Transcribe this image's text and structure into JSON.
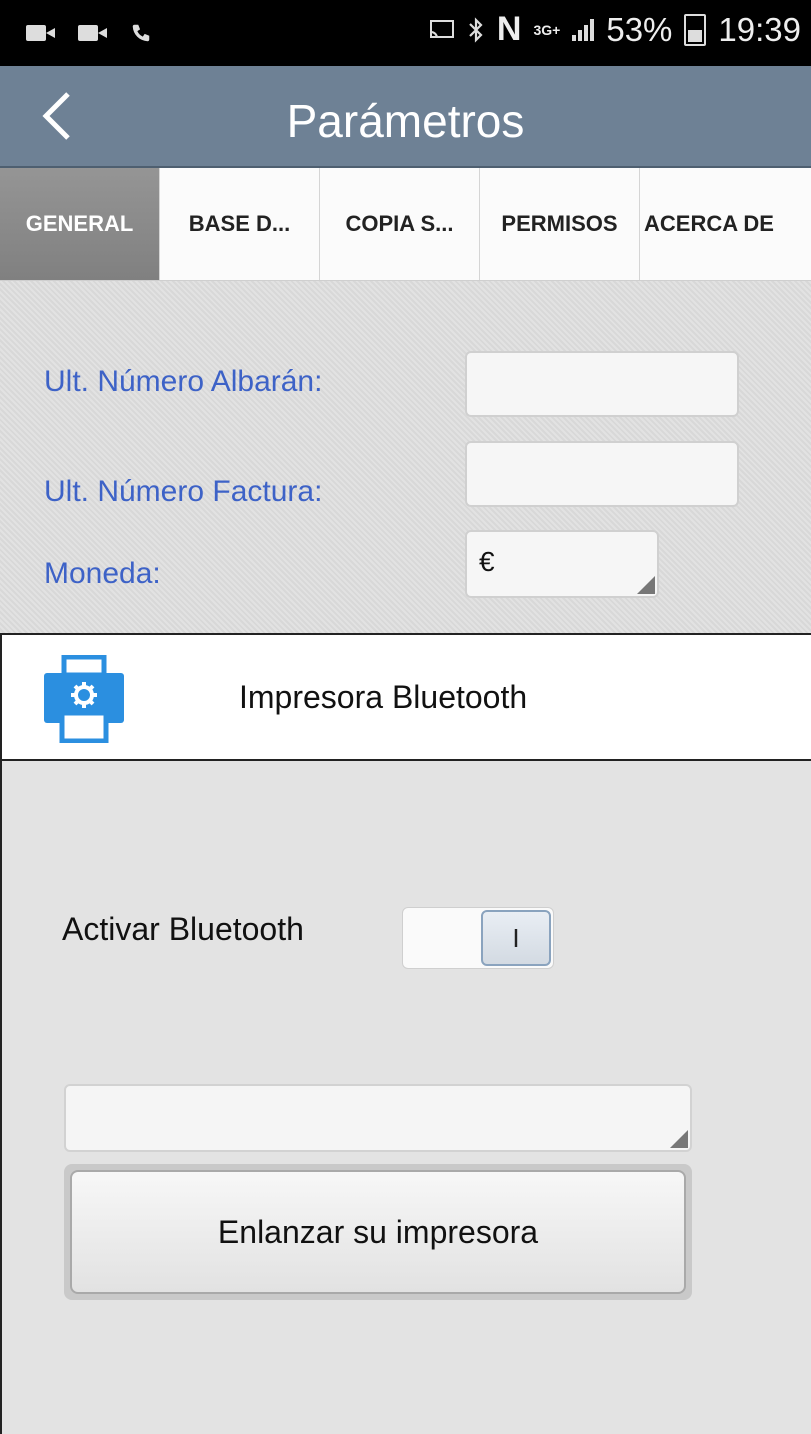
{
  "status_bar": {
    "network": "3G+",
    "battery": "53%",
    "time": "19:39"
  },
  "header": {
    "title": "Parámetros"
  },
  "tabs": [
    {
      "label": "GENERAL",
      "active": true
    },
    {
      "label": "BASE D..."
    },
    {
      "label": "COPIA S..."
    },
    {
      "label": "PERMISOS"
    },
    {
      "label": "ACERCA DE"
    }
  ],
  "form": {
    "albaran_label": "Ult. Número Albarán:",
    "albaran_value": "",
    "factura_label": "Ult. Número Factura:",
    "factura_value": "",
    "moneda_label": "Moneda:",
    "moneda_value": "€"
  },
  "dialog": {
    "title": "Impresora Bluetooth",
    "bluetooth_label": "Activar Bluetooth",
    "toggle_state": "I",
    "printer_select_value": "",
    "link_button": "Enlanzar su impresora"
  },
  "colors": {
    "title_bar": "#6e8195",
    "form_label": "#3d62c7",
    "active_tab": "#8a8a8a",
    "printer_icon": "#2b8fe0"
  }
}
